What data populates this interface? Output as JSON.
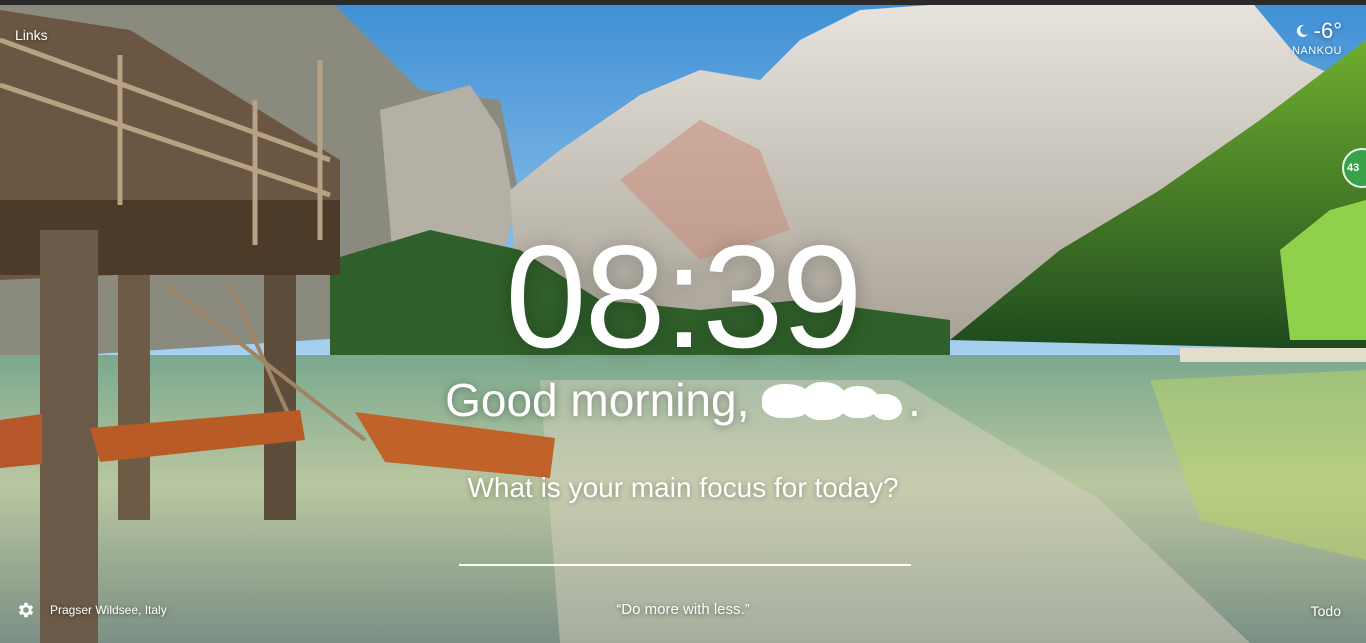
{
  "links_label": "Links",
  "weather": {
    "icon": "moon-icon",
    "temperature": "-6°",
    "location": "NANKOU"
  },
  "side_badge": "43",
  "clock": "08:39",
  "greeting": {
    "prefix": "Good morning, ",
    "suffix": "."
  },
  "focus": {
    "question": "What is your main focus for today?",
    "value": ""
  },
  "photo_location": "Pragser Wildsee, Italy",
  "quote": "“Do more with less.”",
  "todo_label": "Todo",
  "colors": {
    "sky": "#5fa6dd",
    "water": "#6e9f8a",
    "forest": "#2f6a2a",
    "badge": "#37a24a"
  }
}
